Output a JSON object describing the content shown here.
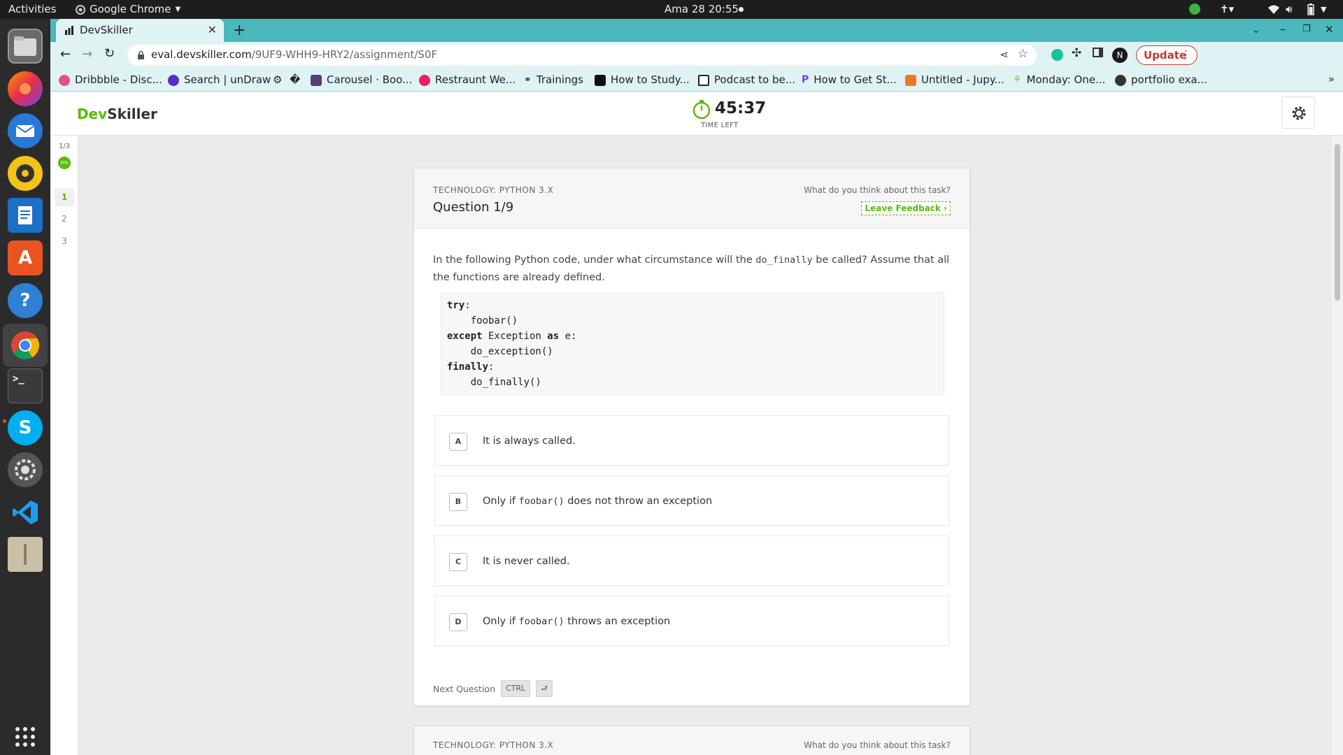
{
  "system_bar": {
    "activities": "Activities",
    "app_name": "Google Chrome",
    "datetime": "Ama 28  20:55"
  },
  "dock": {
    "items": [
      "files",
      "firefox",
      "thunderbird",
      "rhythmbox",
      "writer",
      "app-center",
      "help",
      "chrome",
      "terminal",
      "skype",
      "settings",
      "vscode",
      "archive",
      "show-apps"
    ]
  },
  "browser": {
    "tab_title": "DevSkiller",
    "url_host": "eval.devskiller.com",
    "url_path": "/9UF9-WHH9-HRY2/assignment/S0F",
    "profile_initial": "N",
    "update_label": "Update",
    "bookmarks": [
      {
        "label": "Dribbble - Disc...",
        "color": "#ea4c89"
      },
      {
        "label": "Search | unDraw",
        "color": "#5a2bc7"
      },
      {
        "label": "⚙",
        "color": "#444444"
      },
      {
        "label": "�",
        "color": "#444444"
      },
      {
        "label": "Carousel · Boo...",
        "color": "#563d7c"
      },
      {
        "label": "Restraunt We...",
        "color": "#e91e63"
      },
      {
        "label": "Trainings",
        "color": "#444444"
      },
      {
        "label": "How to Study...",
        "color": "#111111"
      },
      {
        "label": "Podcast to be...",
        "color": "#222222"
      },
      {
        "label": "How to Get St...",
        "color": "#7c3aed"
      },
      {
        "label": "Untitled - Jupy...",
        "color": "#f37626"
      },
      {
        "label": "Monday: One...",
        "color": "#8bc34a"
      },
      {
        "label": "portfolio exa...",
        "color": "#333333"
      }
    ]
  },
  "app": {
    "logo_dev": "Dev",
    "logo_skiller": "Skiller",
    "timer": "45:37",
    "timer_label": "TIME LEFT",
    "progress_fraction": "1/3",
    "progress_percent": "0%",
    "nav_items": [
      "1",
      "2",
      "3"
    ]
  },
  "question": {
    "technology": "TECHNOLOGY: PYTHON 3.X",
    "title": "Question 1/9",
    "feedback_prompt": "What do you think about this task?",
    "feedback_button": "Leave Feedback",
    "prompt_before": "In the following Python code, under what circumstance will the ",
    "prompt_code": "do_finally",
    "prompt_after": " be called? Assume that all the functions are already defined.",
    "code": {
      "kw_try": "try",
      "colon": ":",
      "line_foobar": "    foobar()",
      "kw_except": "except",
      "exception_name": " Exception ",
      "kw_as": "as",
      "var_e": " e:",
      "line_do_exception": "    do_exception()",
      "kw_finally": "finally",
      "line_do_finally": "    do_finally()"
    },
    "options": [
      {
        "key": "A",
        "text_before": "It is always called.",
        "code": "",
        "text_after": ""
      },
      {
        "key": "B",
        "text_before": "Only if ",
        "code": "foobar()",
        "text_after": " does not throw an exception"
      },
      {
        "key": "C",
        "text_before": "It is never called.",
        "code": "",
        "text_after": ""
      },
      {
        "key": "D",
        "text_before": "Only if ",
        "code": "foobar()",
        "text_after": " throws an exception"
      }
    ],
    "next_label": "Next Question",
    "next_key_ctrl": "CTRL",
    "next_key_enter": "⮐"
  },
  "next_card": {
    "technology": "TECHNOLOGY: PYTHON 3.X",
    "feedback_prompt": "What do you think about this task?"
  },
  "colors": {
    "brand_green": "#5cb90c",
    "chrome_teal": "#4ab8bd",
    "update_red": "#c0392b"
  }
}
